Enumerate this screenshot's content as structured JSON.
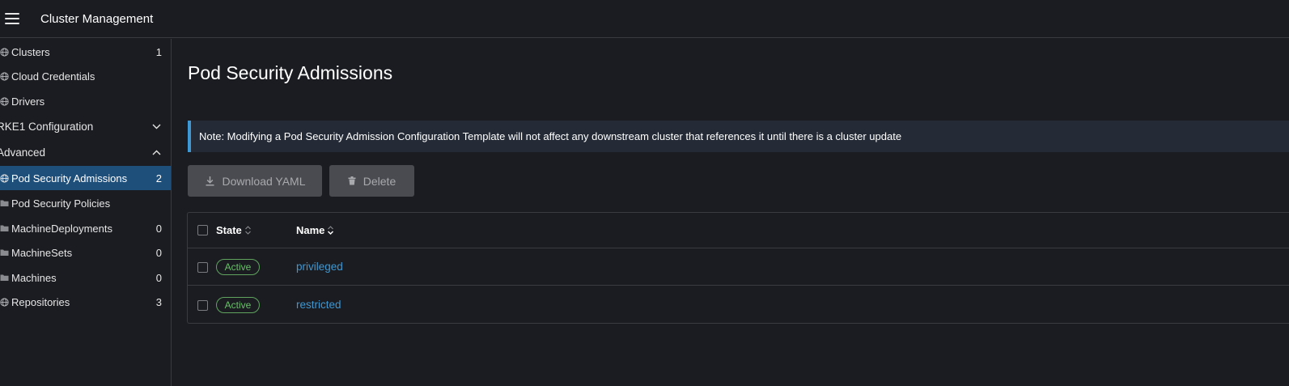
{
  "header": {
    "title": "Cluster Management",
    "menu_icon": "hamburger-icon"
  },
  "sidebar": {
    "items": [
      {
        "label": "Clusters",
        "count": "1",
        "icon": "globe-icon"
      },
      {
        "label": "Cloud Credentials",
        "count": "",
        "icon": "globe-icon"
      },
      {
        "label": "Drivers",
        "count": "",
        "icon": "globe-icon"
      }
    ],
    "group_rke1": {
      "label": "RKE1 Configuration",
      "expanded": false
    },
    "group_advanced": {
      "label": "Advanced",
      "expanded": true
    },
    "advanced_items": [
      {
        "label": "Pod Security Admissions",
        "count": "2",
        "icon": "globe-icon",
        "active": true
      },
      {
        "label": "Pod Security Policies",
        "count": "",
        "icon": "folder-icon"
      },
      {
        "label": "MachineDeployments",
        "count": "0",
        "icon": "folder-icon"
      },
      {
        "label": "MachineSets",
        "count": "0",
        "icon": "folder-icon"
      },
      {
        "label": "Machines",
        "count": "0",
        "icon": "folder-icon"
      },
      {
        "label": "Repositories",
        "count": "3",
        "icon": "globe-icon"
      }
    ]
  },
  "main": {
    "title": "Pod Security Admissions",
    "banner": "Note: Modifying a Pod Security Admission Configuration Template will not affect any downstream cluster that references it until there is a cluster update",
    "buttons": {
      "download": "Download YAML",
      "delete": "Delete"
    },
    "table": {
      "columns": {
        "state": "State",
        "name": "Name"
      },
      "rows": [
        {
          "state": "Active",
          "name": "privileged"
        },
        {
          "state": "Active",
          "name": "restricted"
        }
      ]
    }
  },
  "colors": {
    "accent": "#3d98d3",
    "active_bg": "#1e4f7a",
    "active_badge": "#6bbf6b",
    "background": "#1b1c21"
  }
}
